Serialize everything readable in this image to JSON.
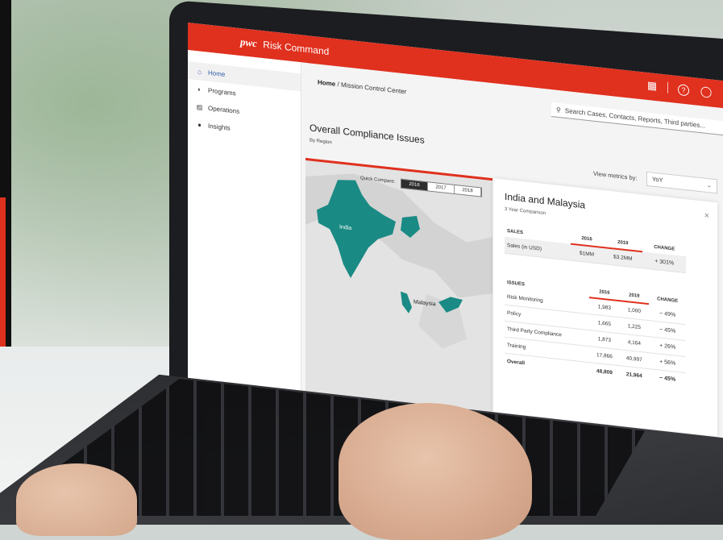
{
  "app": {
    "brand_logo": "pwc",
    "brand_name": "Risk Command",
    "accent_color": "#e0301e",
    "topbar_icons": [
      "apps-grid-icon",
      "help-icon",
      "chat-icon"
    ]
  },
  "sidebar": {
    "items": [
      {
        "label": "Home",
        "icon": "home-icon",
        "active": true
      },
      {
        "label": "Programs",
        "icon": "programs-icon",
        "active": false
      },
      {
        "label": "Operations",
        "icon": "document-icon",
        "active": false
      },
      {
        "label": "Insights",
        "icon": "info-icon",
        "active": false
      }
    ]
  },
  "header": {
    "breadcrumb_home": "Home",
    "breadcrumb_sep": "/",
    "breadcrumb_current": "Mission Control Center",
    "search_placeholder": "Search Cases, Contacts, Reports, Third parties..."
  },
  "main": {
    "title": "Overall Compliance Issues",
    "subtitle": "By Region",
    "metrics_label": "View metrics by:",
    "metrics_value": "YoY"
  },
  "map": {
    "quick_compare_label": "Quick Compare:",
    "years": [
      "2016",
      "2017",
      "2018"
    ],
    "selected_year": "2016",
    "region_labels": [
      "India",
      "Malaysia"
    ],
    "highlight_color": "#1a8a84"
  },
  "detail": {
    "title": "India and Malaysia",
    "subtitle": "3 Year Comparison",
    "sales": {
      "header": "SALES",
      "col_a": "2016",
      "col_b": "2019",
      "col_change": "CHANGE",
      "rows": [
        {
          "label": "Sales (in USD)",
          "a": "$1MM",
          "b": "$3.2MM",
          "change": "+ 301%"
        }
      ]
    },
    "issues": {
      "header": "ISSUES",
      "col_a": "2016",
      "col_b": "2019",
      "col_change": "CHANGE",
      "rows": [
        {
          "label": "Risk Monitoring",
          "a": "1,983",
          "b": "1,000",
          "change": "− 49%"
        },
        {
          "label": "Policy",
          "a": "1,665",
          "b": "1,225",
          "change": "− 45%"
        },
        {
          "label": "Third Party Compliance",
          "a": "1,873",
          "b": "4,164",
          "change": "+ 26%"
        },
        {
          "label": "Training",
          "a": "17,866",
          "b": "40,997",
          "change": "+ 56%"
        },
        {
          "label": "Overall",
          "a": "48,809",
          "b": "21,964",
          "change": "− 45%"
        }
      ]
    }
  }
}
